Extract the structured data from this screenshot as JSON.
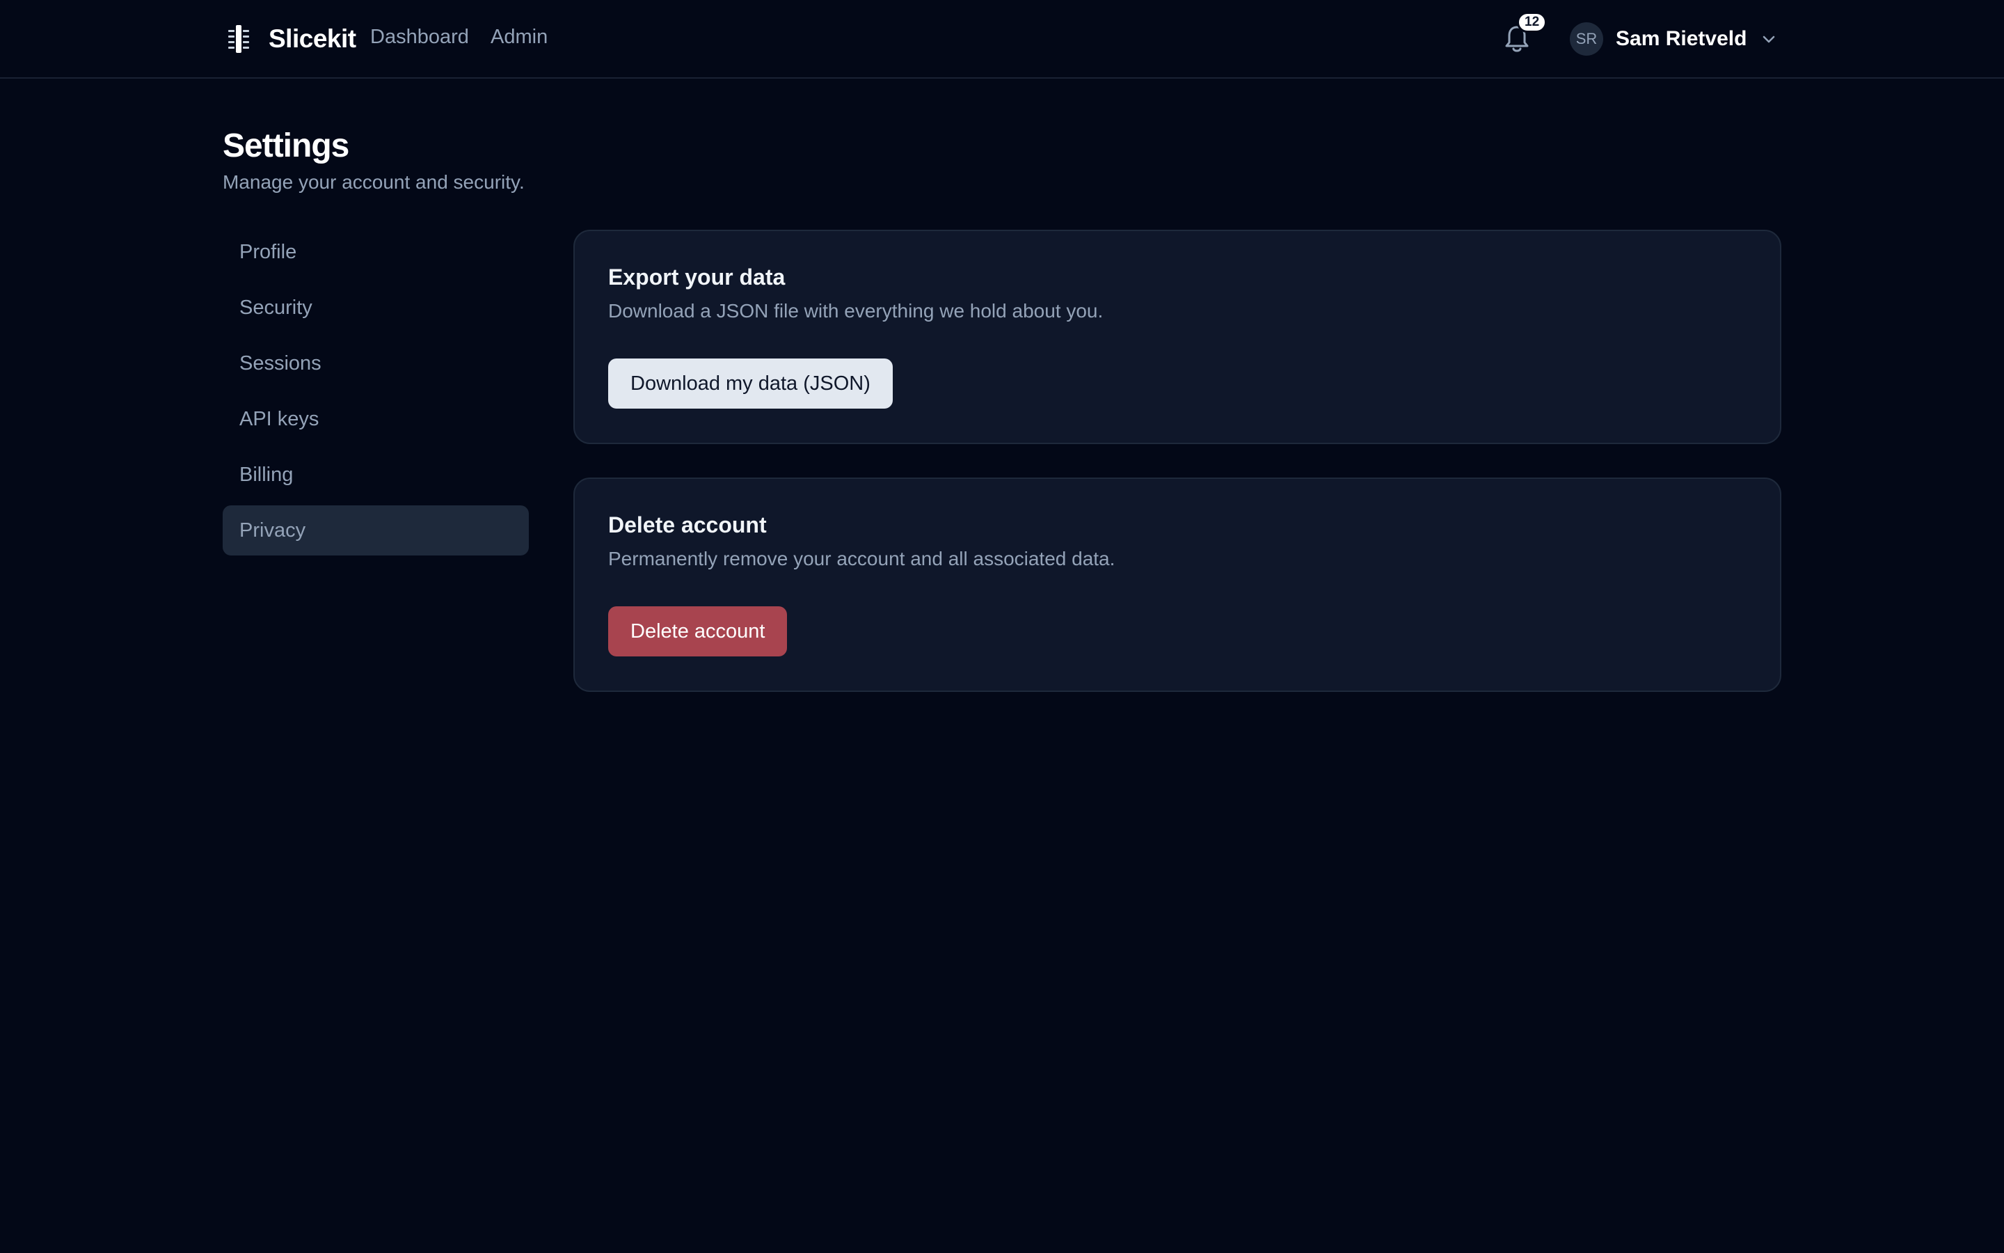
{
  "header": {
    "brand_name": "Slicekit",
    "brand_icon": "slice-logo-icon",
    "nav": [
      {
        "label": "Dashboard"
      },
      {
        "label": "Admin"
      }
    ],
    "notifications": {
      "icon": "bell-icon",
      "count": "12"
    },
    "user": {
      "initials": "SR",
      "name": "Sam Rietveld",
      "menu_icon": "chevron-down-icon"
    }
  },
  "page": {
    "title": "Settings",
    "subtitle": "Manage your account and security."
  },
  "sidebar": {
    "items": [
      {
        "label": "Profile"
      },
      {
        "label": "Security"
      },
      {
        "label": "Sessions"
      },
      {
        "label": "API keys"
      },
      {
        "label": "Billing"
      },
      {
        "label": "Privacy",
        "active": true
      }
    ]
  },
  "export_card": {
    "title": "Export your data",
    "description": "Download a JSON file with everything we hold about you.",
    "button_label": "Download my data (JSON)"
  },
  "delete_card": {
    "title": "Delete account",
    "description": "Permanently remove your account and all associated data.",
    "button_label": "Delete account"
  },
  "colors": {
    "background": "#030817",
    "card": "#0f172a",
    "active_nav": "#1e293b",
    "danger": "#a8444f"
  }
}
